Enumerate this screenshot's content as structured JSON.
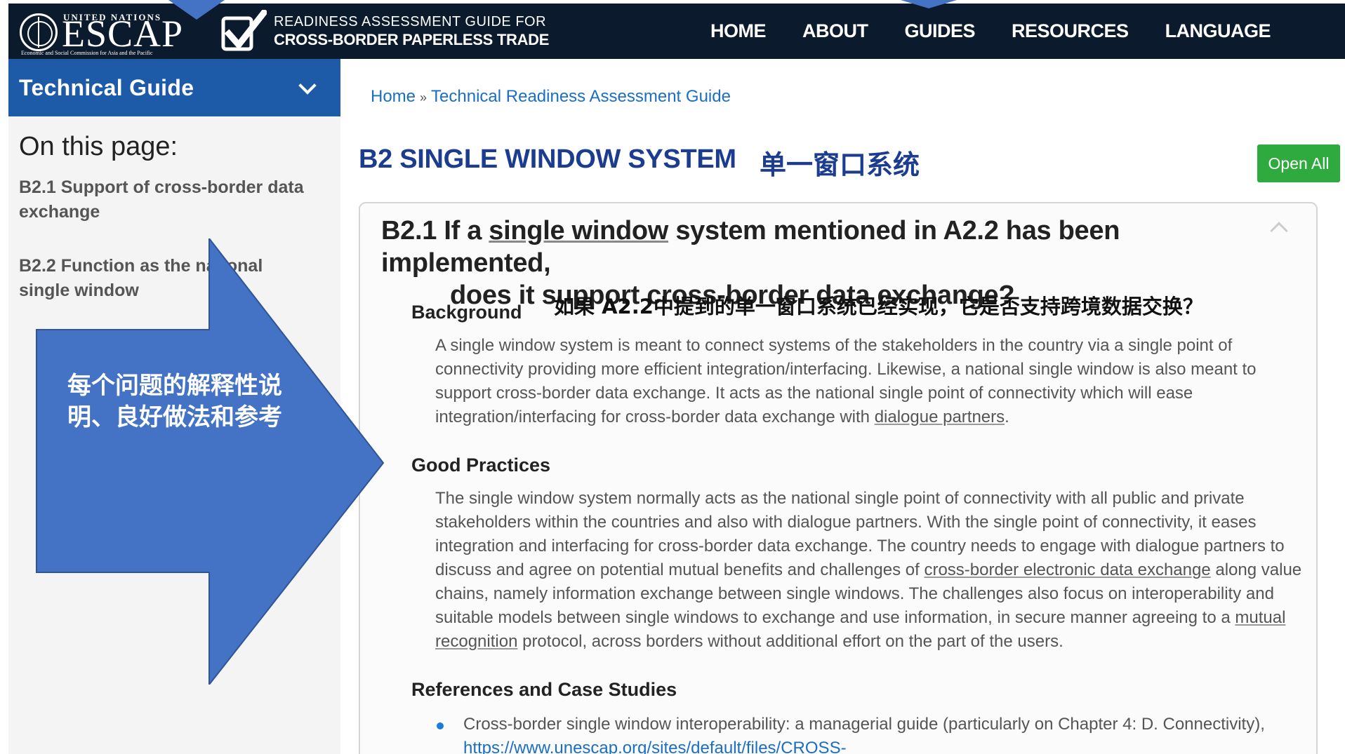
{
  "header": {
    "un_label": "UNITED NATIONS",
    "org_name": "ESCAP",
    "org_subtitle": "Economic and Social Commission for Asia and the Pacific",
    "site_title_line1": "READINESS ASSESSMENT GUIDE FOR",
    "site_title_line2": "CROSS-BORDER PAPERLESS TRADE",
    "nav": [
      "HOME",
      "ABOUT",
      "GUIDES",
      "RESOURCES",
      "LANGUAGE"
    ]
  },
  "sidebar": {
    "section_title": "Technical Guide",
    "on_this_page": "On this page:",
    "links": [
      "B2.1 Support of cross-border data exchange",
      "B2.2 Function as the national single window"
    ]
  },
  "callout": {
    "text": "每个问题的解释性说明、良好做法和参考",
    "color": "#4472c4"
  },
  "breadcrumb": {
    "home": "Home",
    "separator": "»",
    "current": "Technical Readiness Assessment Guide"
  },
  "main": {
    "title": "B2 SINGLE WINDOW SYSTEM",
    "title_cn": "单一窗口系统",
    "open_all": "Open All",
    "question": {
      "prefix": "B2.1 If a ",
      "link1": "single window",
      "rest_line1": " system mentioned in A2.2 has been implemented,",
      "line2": "does it support cross-border data exchange?",
      "cn": "如果 A2.2中提到的单一窗口系统已经实现，它是否支持跨境数据交换？"
    },
    "background_heading": "Background",
    "background_text_pre": "A single window system is meant to connect systems of the stakeholders in the country via a single point of connectivity providing more efficient integration/interfacing. Likewise, a national single window is also meant to support cross-border data exchange. It acts as the national single point of connectivity which will ease integration/interfacing for cross-border data exchange with ",
    "background_link": "dialogue partners",
    "background_text_post": ".",
    "good_practices_heading": "Good Practices",
    "gp_text_1": "The single window system normally acts as the national single point of connectivity with all public and private stakeholders within the countries and also with dialogue partners. With the single point of connectivity, it eases integration and interfacing for cross-border data exchange. The country needs to engage with dialogue partners to discuss and agree on potential mutual benefits and challenges of ",
    "gp_link_1": "cross-border electronic data exchange",
    "gp_text_2": " along value chains, namely information exchange between single windows. The challenges also focus on interoperability and suitable models between single windows to exchange and use information, in secure manner agreeing to a ",
    "gp_link_2": "mutual recognition",
    "gp_text_3": " protocol, across borders without additional effort on the part of the users.",
    "references_heading": "References and Case Studies",
    "reference_1": "Cross-border single window interoperability: a managerial guide (particularly on Chapter 4: D. Connectivity),",
    "reference_1_url": "https://www.unescap.org/sites/default/files/CROSS-"
  },
  "colors": {
    "topbar": "#0b1a2c",
    "sidebar_head": "#1d5aa8",
    "title": "#1c3d8f",
    "link": "#1a6fc4",
    "open_all": "#2eaa3e",
    "arrow": "#4472c4"
  }
}
